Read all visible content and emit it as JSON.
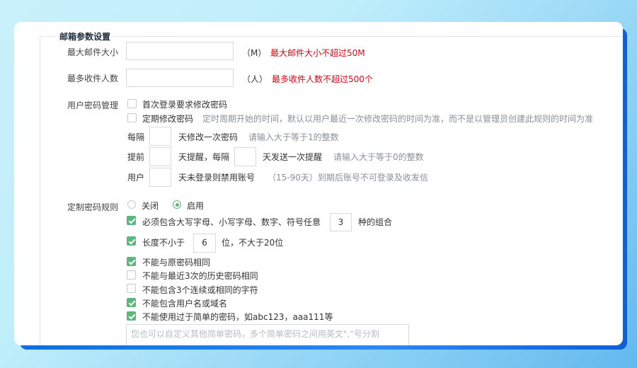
{
  "section": {
    "title": "邮箱参数设置"
  },
  "max_size": {
    "label": "最大邮件大小",
    "value": "",
    "unit": "（M）",
    "hint": "最大邮件大小不超过50M"
  },
  "max_recipients": {
    "label": "最多收件人数",
    "value": "",
    "unit": "（人）",
    "hint": "最多收件人数不超过500个"
  },
  "password_mgmt": {
    "label": "用户密码管理",
    "first_login": {
      "label": "首次登录要求修改密码",
      "checked": false
    },
    "periodic": {
      "label": "定期修改密码",
      "checked": false,
      "note": "定时周期开始的时间，默认以用户最近一次修改密码的时间为准，而不是以管理员创建此规则的时间为准"
    },
    "every": {
      "prefix": "每隔",
      "value": "",
      "suffix": "天修改一次密码",
      "hint": "请输入大于等于1的整数"
    },
    "remind": {
      "prefix": "提前",
      "value1": "",
      "mid": "天提醒，每隔",
      "value2": "",
      "suffix": "天发送一次提醒",
      "hint": "请输入大于等于0的整数"
    },
    "inactive": {
      "prefix": "用户",
      "value": "",
      "suffix": "天未登录则禁用账号",
      "hint": "（15-90天）到期后账号不可登录及收发信"
    }
  },
  "custom_rules": {
    "label": "定制密码规则",
    "off_label": "关闭",
    "on_label": "启用",
    "enabled": true,
    "rules": {
      "combo": {
        "checked": true,
        "prefix": "必须包含大写字母、小写字母、数字、符号任意",
        "value": "3",
        "suffix": "种的组合"
      },
      "length": {
        "checked": true,
        "prefix": "长度不小于",
        "value": "6",
        "suffix": "位，不大于20位"
      },
      "not_same": {
        "checked": true,
        "label": "不能与原密码相同"
      },
      "history": {
        "checked": false,
        "label": "不能与最近3次的历史密码相同"
      },
      "consecutive": {
        "checked": false,
        "label": "不能包含3个连续或相同的字符"
      },
      "username": {
        "checked": true,
        "label": "不能包含用户名或域名"
      },
      "simple": {
        "checked": true,
        "label": "不能使用过于简单的密码，如abc123，aaa111等"
      }
    },
    "custom_placeholder": "您也可以自定义其他简单密码，多个简单密码之间用英文\",\"号分割"
  },
  "colors": {
    "accent": "#5cb87a",
    "warning": "#e60012",
    "brand_blue": "#1572e8"
  }
}
